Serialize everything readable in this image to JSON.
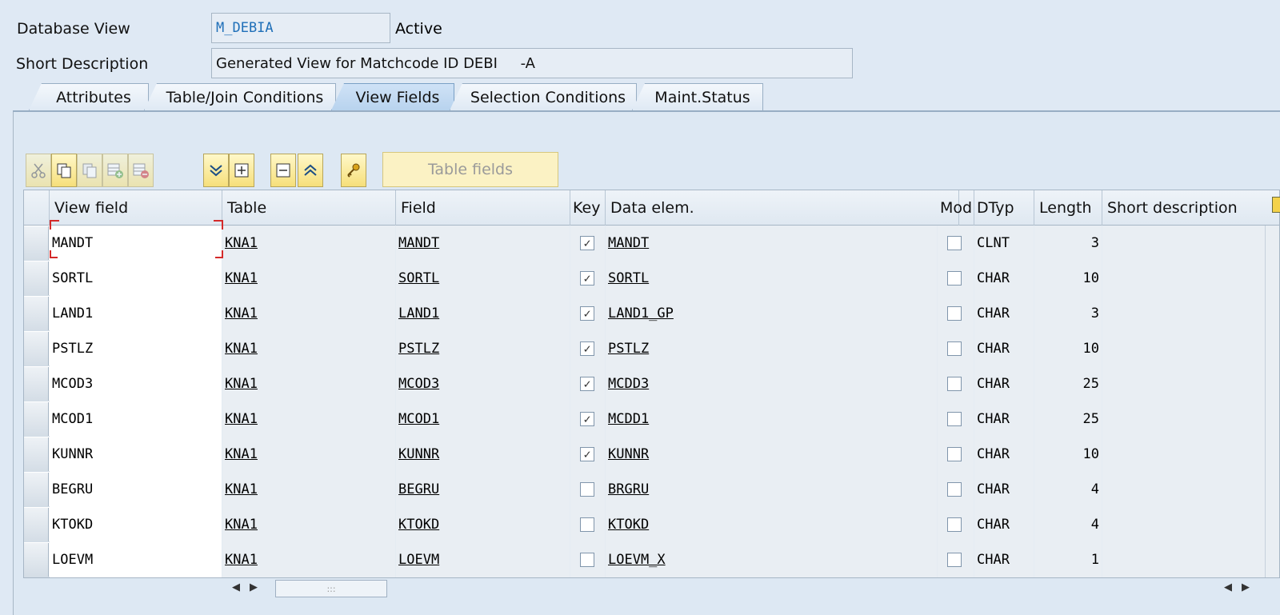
{
  "header": {
    "db_view_label": "Database View",
    "db_view_value": "M_DEBIA",
    "db_view_status": "Active",
    "short_desc_label": "Short Description",
    "short_desc_value": "Generated View for Matchcode ID DEBI     -A"
  },
  "tabs": [
    {
      "label": "Attributes",
      "active": false
    },
    {
      "label": "Table/Join Conditions",
      "active": false
    },
    {
      "label": "View Fields",
      "active": true
    },
    {
      "label": "Selection Conditions",
      "active": false
    },
    {
      "label": "Maint.Status",
      "active": false
    }
  ],
  "toolbar": {
    "icons": [
      "cut-icon",
      "copy-icon",
      "paste-icon",
      "insert-row-icon",
      "delete-row-icon",
      "expand-icon",
      "select-all-icon",
      "deselect-icon",
      "collapse-icon",
      "key-icon"
    ],
    "table_fields_label": "Table fields"
  },
  "columns": [
    "View field",
    "Table",
    "Field",
    "Key",
    "Data elem.",
    "Mod",
    "DTyp",
    "Length",
    "Short description"
  ],
  "rows": [
    {
      "view_field": "MANDT",
      "table": "KNA1",
      "field": "MANDT",
      "key": true,
      "data_elem": "MANDT",
      "mod": false,
      "dtyp": "CLNT",
      "length": "3",
      "short_description": ""
    },
    {
      "view_field": "SORTL",
      "table": "KNA1",
      "field": "SORTL",
      "key": true,
      "data_elem": "SORTL",
      "mod": false,
      "dtyp": "CHAR",
      "length": "10",
      "short_description": ""
    },
    {
      "view_field": "LAND1",
      "table": "KNA1",
      "field": "LAND1",
      "key": true,
      "data_elem": "LAND1_GP",
      "mod": false,
      "dtyp": "CHAR",
      "length": "3",
      "short_description": ""
    },
    {
      "view_field": "PSTLZ",
      "table": "KNA1",
      "field": "PSTLZ",
      "key": true,
      "data_elem": "PSTLZ",
      "mod": false,
      "dtyp": "CHAR",
      "length": "10",
      "short_description": ""
    },
    {
      "view_field": "MCOD3",
      "table": "KNA1",
      "field": "MCOD3",
      "key": true,
      "data_elem": "MCDD3",
      "mod": false,
      "dtyp": "CHAR",
      "length": "25",
      "short_description": ""
    },
    {
      "view_field": "MCOD1",
      "table": "KNA1",
      "field": "MCOD1",
      "key": true,
      "data_elem": "MCDD1",
      "mod": false,
      "dtyp": "CHAR",
      "length": "25",
      "short_description": ""
    },
    {
      "view_field": "KUNNR",
      "table": "KNA1",
      "field": "KUNNR",
      "key": true,
      "data_elem": "KUNNR",
      "mod": false,
      "dtyp": "CHAR",
      "length": "10",
      "short_description": ""
    },
    {
      "view_field": "BEGRU",
      "table": "KNA1",
      "field": "BEGRU",
      "key": false,
      "data_elem": "BRGRU",
      "mod": false,
      "dtyp": "CHAR",
      "length": "4",
      "short_description": ""
    },
    {
      "view_field": "KTOKD",
      "table": "KNA1",
      "field": "KTOKD",
      "key": false,
      "data_elem": "KTOKD",
      "mod": false,
      "dtyp": "CHAR",
      "length": "4",
      "short_description": ""
    },
    {
      "view_field": "LOEVM",
      "table": "KNA1",
      "field": "LOEVM",
      "key": false,
      "data_elem": "LOEVM_X",
      "mod": false,
      "dtyp": "CHAR",
      "length": "1",
      "short_description": ""
    }
  ],
  "colors": {
    "accent": "#1f6fb8",
    "toolbar_button": "#f6df7a",
    "focus": "#d42a2a"
  }
}
